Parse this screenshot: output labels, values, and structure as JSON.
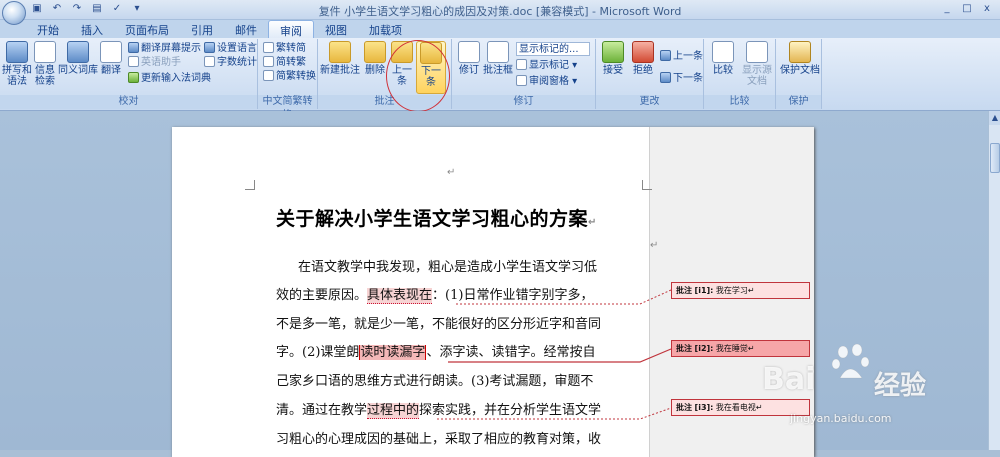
{
  "window": {
    "title": "复件 小学生语文学习粗心的成因及对策.doc [兼容模式] - Microsoft Word",
    "qat_icons": [
      "save-icon",
      "undo-icon",
      "redo-icon",
      "print-icon",
      "spelling-icon",
      "customize-icon"
    ],
    "controls": [
      "_",
      "□",
      "x"
    ]
  },
  "tabs": [
    "开始",
    "插入",
    "页面布局",
    "引用",
    "邮件",
    "审阅",
    "视图",
    "加载项"
  ],
  "active_tab": "审阅",
  "ribbon": {
    "proofing": {
      "label": "校对",
      "buttons": [
        {
          "label": "拼写和",
          "label2": "语法"
        },
        {
          "label": "信息",
          "label2": "检索"
        },
        {
          "label": "同义词库"
        },
        {
          "label": "翻译"
        }
      ],
      "small": [
        "翻译屏幕提示 ▾",
        "英语助手",
        "更新输入法词典",
        "设置语言",
        "字数统计"
      ]
    },
    "chinese": {
      "label": "中文简繁转换",
      "small": [
        "繁转简",
        "简转繁",
        "简繁转换"
      ]
    },
    "comments": {
      "label": "批注",
      "buttons": [
        "新建批注",
        "删除",
        "上一条",
        "下一条"
      ],
      "prev_lines": [
        "上一",
        "条"
      ],
      "next_lines": [
        "下一",
        "条"
      ]
    },
    "tracking": {
      "label": "修订",
      "buttons": [
        "修订",
        "批注框"
      ],
      "dropdown_value": "显示标记的...",
      "small": [
        "显示标记 ▾",
        "审阅窗格 ▾"
      ]
    },
    "changes": {
      "label": "更改",
      "buttons": [
        "接受",
        "拒绝"
      ],
      "small": [
        "上一条",
        "下一条"
      ]
    },
    "compare": {
      "label": "比较",
      "buttons": [
        "比较",
        "显示源文档"
      ]
    },
    "protect": {
      "label": "保护",
      "buttons": [
        "保护文档"
      ]
    }
  },
  "document": {
    "title": "关于解决小学生语文学习粗心的方案",
    "paragraph_mark": "↵",
    "lines": [
      {
        "a": "在语文教学中我发现，粗心是造成小学生语文学习低"
      },
      {
        "a": "效的主要原因。",
        "h": "具体表现在",
        "b": "：(1)日常作业错字别字多，"
      },
      {
        "a": "不是多一笔，就是少一笔，不能很好的区分形近字和音同"
      },
      {
        "a": "字。(2)课堂朗",
        "h": "读时读漏字",
        "b": "、添字读、读错字。经常按自"
      },
      {
        "a": "己家乡口语的思维方式进行朗读。(3)考试漏题，审题不"
      },
      {
        "a": "清。通过在教学",
        "h": "过程中的",
        "b": "探索实践，并在分析学生语文学"
      },
      {
        "a": "习粗心的心理成因的基础上，采取了相应的教育对策，收"
      }
    ]
  },
  "comments": [
    {
      "label": "批注",
      "id": "[i1]:",
      "text": "我在学习",
      "mark": "↵"
    },
    {
      "label": "批注",
      "id": "[i2]:",
      "text": "我在睡觉",
      "mark": "↵"
    },
    {
      "label": "批注",
      "id": "[i3]:",
      "text": "我在看电视",
      "mark": "↵"
    }
  ],
  "watermark": {
    "brand": "Bai",
    "brand_cn": "经验",
    "url": "jingyan.baidu.com"
  },
  "colors": {
    "ribbon_bg": "#dbe7f6",
    "comment_border": "#c0343c",
    "comment_fill": "#fde1e1",
    "highlight": "#f6d3d3",
    "annotation_circle": "#d03038"
  }
}
